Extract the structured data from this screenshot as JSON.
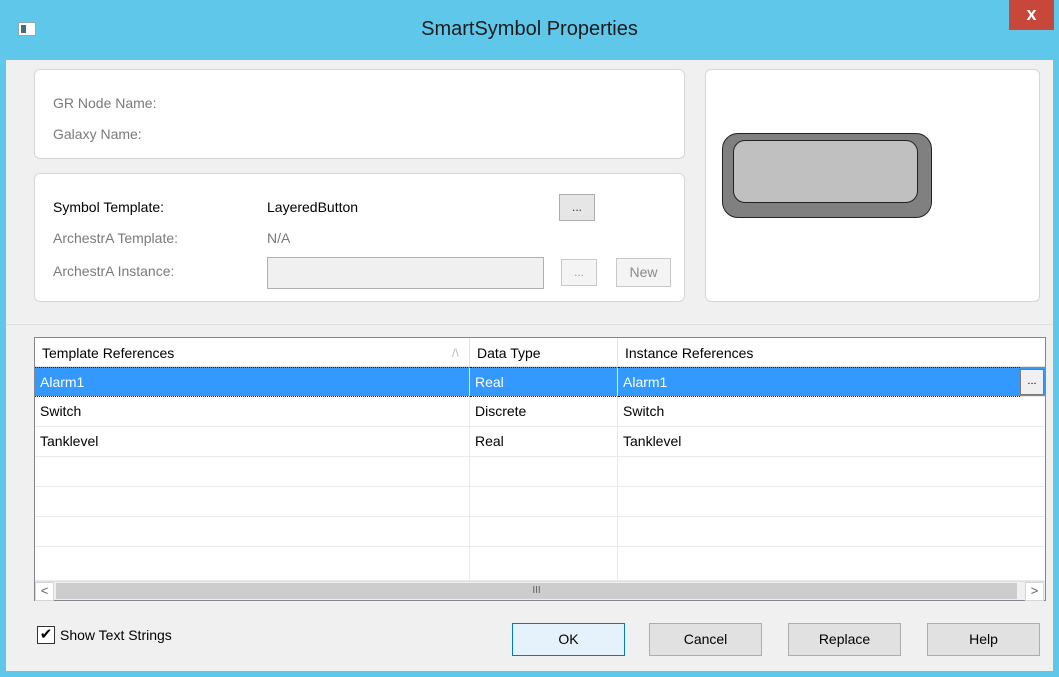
{
  "window": {
    "title": "SmartSymbol Properties",
    "close_glyph": "x",
    "accent_color": "#5fc8ea"
  },
  "info": {
    "gr_node_label": "GR Node Name:",
    "galaxy_label": "Galaxy Name:"
  },
  "template": {
    "symbol_template_label": "Symbol Template:",
    "symbol_template_value": "LayeredButton",
    "browse_label": "...",
    "archestra_template_label": "ArchestrA Template:",
    "archestra_template_value": "N/A",
    "archestra_instance_label": "ArchestrA Instance:",
    "archestra_instance_value": "",
    "instance_browse_label": "...",
    "new_label": "New"
  },
  "grid": {
    "columns": [
      "Template References",
      "Data Type",
      "Instance References"
    ],
    "sort_glyph": "/\\",
    "rows": [
      {
        "template_ref": "Alarm1",
        "data_type": "Real",
        "instance_ref": "Alarm1"
      },
      {
        "template_ref": "Switch",
        "data_type": "Discrete",
        "instance_ref": "Switch"
      },
      {
        "template_ref": "Tanklevel",
        "data_type": "Real",
        "instance_ref": "Tanklevel"
      }
    ],
    "row_ellipsis": "...",
    "scroll_left": "<",
    "scroll_right": ">",
    "scroll_grip": "III"
  },
  "footer": {
    "show_text_strings_label": "Show Text Strings",
    "show_text_strings_checked": "✔",
    "ok_label": "OK",
    "cancel_label": "Cancel",
    "replace_label": "Replace",
    "help_label": "Help"
  }
}
